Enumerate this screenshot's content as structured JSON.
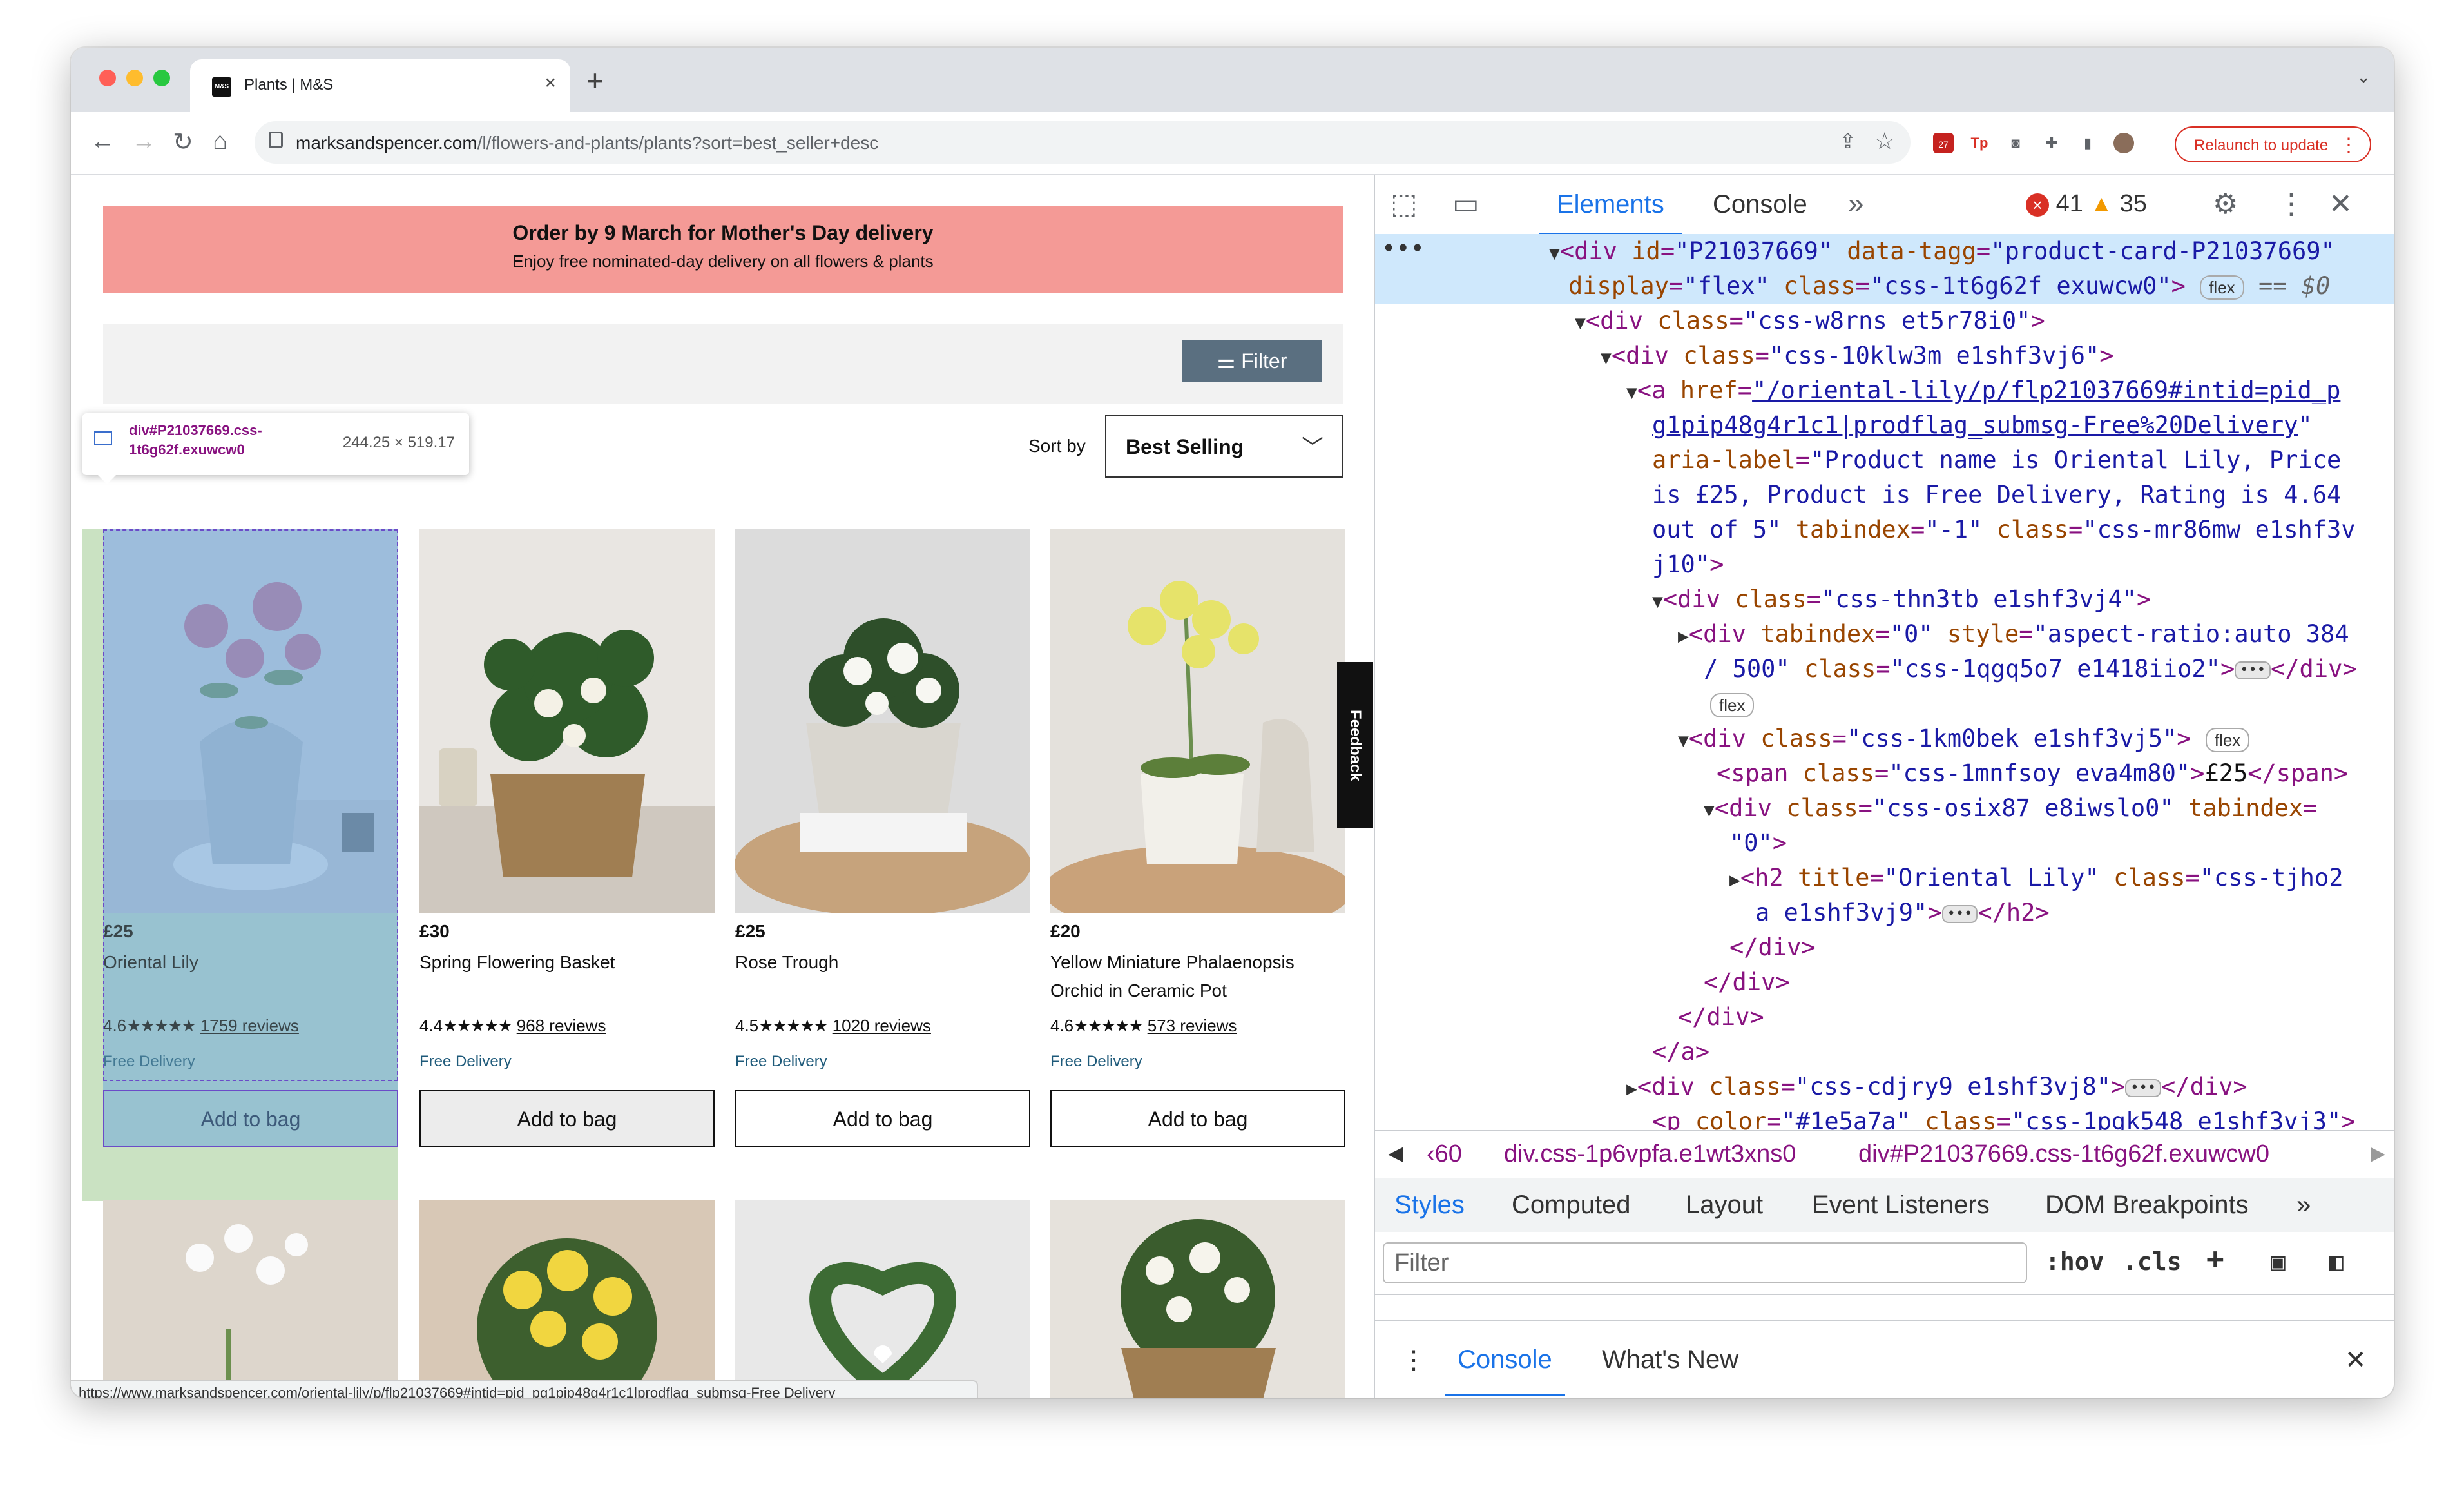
{
  "browser": {
    "tab_title": "Plants | M&S",
    "tab_favicon": "M&S",
    "url_host": "marksandspencer.com",
    "url_path": "/l/flowers-and-plants/plants?sort=best_seller+desc",
    "relaunch_label": "Relaunch to update",
    "ext_badge": "27"
  },
  "page": {
    "banner_title": "Order by 9 March for Mother's Day delivery",
    "banner_sub": "Enjoy free nominated-day delivery on all flowers & plants",
    "filter_label": "Filter",
    "sort_label": "Sort by",
    "sort_value": "Best Selling",
    "inspect_selector": "div#P21037669.css-1t6g62f.exuwcw0",
    "inspect_size": "244.25 × 519.17",
    "feedback_label": "Feedback",
    "status_url": "https://www.marksandspencer.com/oriental-lily/p/flp21037669#intid=pid_pg1pip48g4r1c1|prodflag_submsg-Free Delivery",
    "products": [
      {
        "price": "£25",
        "name": "Oriental Lily",
        "rating": "4.6",
        "stars": "★★★★★",
        "reviews": "1759 reviews",
        "delivery": "Free Delivery",
        "button": "Add to bag"
      },
      {
        "price": "£30",
        "name": "Spring Flowering Basket",
        "rating": "4.4",
        "stars": "★★★★★",
        "reviews": "968 reviews",
        "delivery": "Free Delivery",
        "button": "Add to bag"
      },
      {
        "price": "£25",
        "name": "Rose Trough",
        "rating": "4.5",
        "stars": "★★★★★",
        "reviews": "1020 reviews",
        "delivery": "Free Delivery",
        "button": "Add to bag"
      },
      {
        "price": "£20",
        "name": "Yellow Miniature Phalaenopsis Orchid in Ceramic Pot",
        "rating": "4.6",
        "stars": "★★★★★",
        "reviews": "573 reviews",
        "delivery": "Free Delivery",
        "button": "Add to bag"
      }
    ]
  },
  "devtools": {
    "tabs": [
      "Elements",
      "Console"
    ],
    "errors": "41",
    "warnings": "35",
    "crumbs": [
      "‹60",
      "div.css-1p6vpfa.e1wt3xns0",
      "div#P21037669.css-1t6g62f.exuwcw0"
    ],
    "style_tabs": [
      "Styles",
      "Computed",
      "Layout",
      "Event Listeners",
      "DOM Breakpoints"
    ],
    "filter_placeholder": "Filter",
    "hov": ":hov",
    "cls": ".cls",
    "drawer_tabs": [
      "Console",
      "What's New"
    ],
    "flex_pill": "flex",
    "dollar_zero": "== $0"
  },
  "colors": {
    "banner": "#f49a96",
    "filter_button": "#5a6f80",
    "devtools_accent": "#1a73e8",
    "relaunch": "#d93025"
  }
}
